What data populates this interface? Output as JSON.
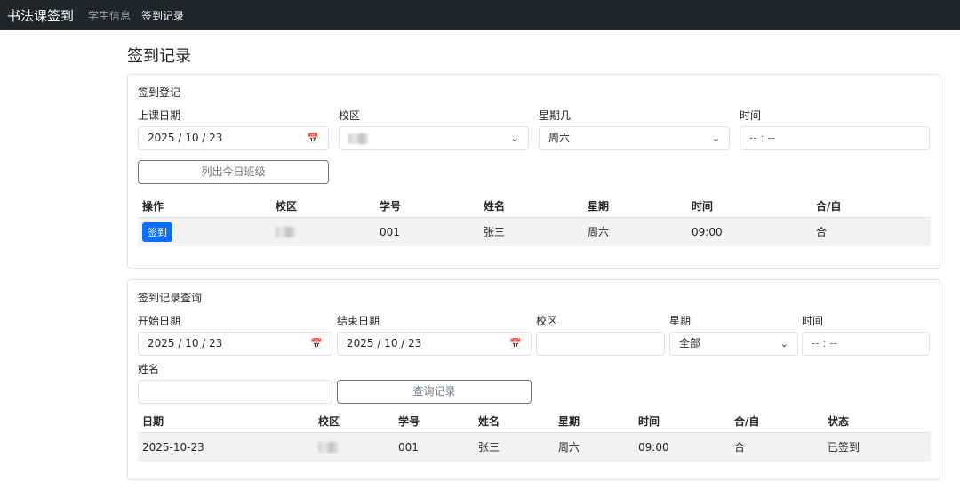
{
  "nav": {
    "brand": "书法课签到",
    "links": [
      {
        "label": "学生信息",
        "active": false
      },
      {
        "label": "签到记录",
        "active": true
      }
    ]
  },
  "page_title": "签到记录",
  "checkin": {
    "title": "签到登记",
    "fields": {
      "date": {
        "label": "上课日期",
        "value": "2025 / 10 / 23"
      },
      "campus": {
        "label": "校区",
        "value": ""
      },
      "weekday": {
        "label": "星期几",
        "value": "周六"
      },
      "time": {
        "label": "时间",
        "placeholder": "-- : --"
      }
    },
    "list_button": "列出今日班级",
    "table": {
      "headers": [
        "操作",
        "校区",
        "学号",
        "姓名",
        "星期",
        "时间",
        "合/自"
      ],
      "rows": [
        {
          "action": "签到",
          "campus": "",
          "id": "001",
          "name": "张三",
          "weekday": "周六",
          "time": "09:00",
          "type": "合"
        }
      ]
    }
  },
  "query": {
    "title": "签到记录查询",
    "fields": {
      "start_date": {
        "label": "开始日期",
        "value": "2025 / 10 / 23"
      },
      "end_date": {
        "label": "结束日期",
        "value": "2025 / 10 / 23"
      },
      "campus": {
        "label": "校区",
        "value": ""
      },
      "weekday": {
        "label": "星期",
        "value": "全部"
      },
      "time": {
        "label": "时间",
        "placeholder": "-- : --"
      },
      "name": {
        "label": "姓名",
        "value": ""
      }
    },
    "query_button": "查询记录",
    "table": {
      "headers": [
        "日期",
        "校区",
        "学号",
        "姓名",
        "星期",
        "时间",
        "合/自",
        "状态"
      ],
      "rows": [
        {
          "date": "2025-10-23",
          "campus": "",
          "id": "001",
          "name": "张三",
          "weekday": "周六",
          "time": "09:00",
          "type": "合",
          "status": "已签到"
        }
      ]
    }
  },
  "icons": {
    "calendar": "calendar-icon",
    "chevron": "chevron-down-icon"
  },
  "colors": {
    "navbar": "#212529",
    "primary": "#0d6efd",
    "row_bg": "#f2f2f2"
  }
}
